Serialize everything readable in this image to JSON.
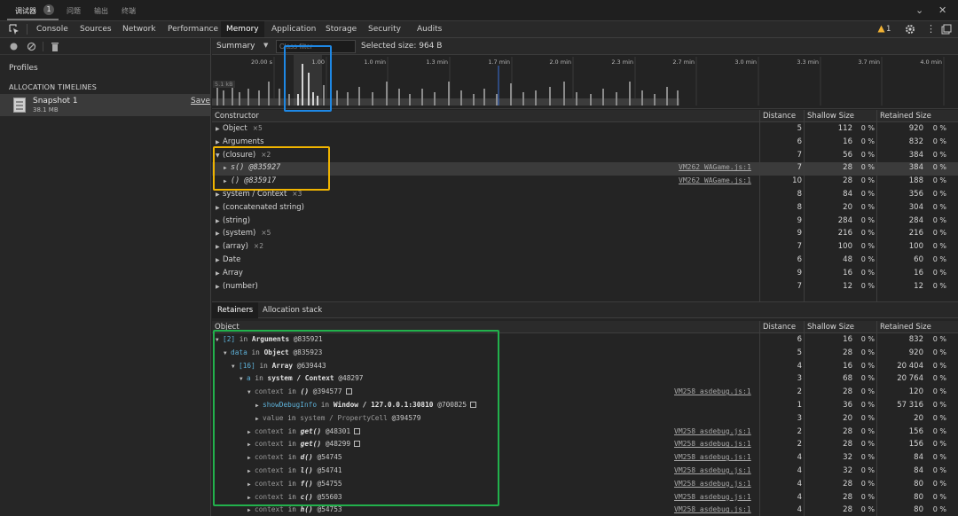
{
  "drawer": {
    "tabs": [
      "调试器",
      "问题",
      "输出",
      "终端"
    ],
    "badge": "1",
    "more_icon": "chevron-down-icon",
    "close_icon": "close-icon"
  },
  "panels": {
    "tabs": [
      "Console",
      "Sources",
      "Network",
      "Performance",
      "Memory",
      "Application",
      "Storage",
      "Security",
      "Audits"
    ],
    "active": "Memory",
    "warning_count": "1",
    "warning_icon": "warning-icon",
    "warning_color": "#f2b233"
  },
  "sidebar": {
    "profiles_label": "Profiles",
    "section_label": "ALLOCATION TIMELINES",
    "snapshot": {
      "name": "Snapshot 1",
      "size": "38.1 MB",
      "save_label": "Save"
    }
  },
  "toolbar": {
    "view": "Summary",
    "filter_placeholder": "Class filter",
    "selected_size": "Selected size: 964 B"
  },
  "timeline": {
    "ticks": [
      "20.00 s",
      "1.00",
      "1.0 min",
      "1.3 min",
      "1.7 min",
      "2.0 min",
      "2.3 min",
      "2.7 min",
      "3.0 min",
      "3.3 min",
      "3.7 min",
      "4.0 min"
    ],
    "scale_label": "5.1 kB"
  },
  "constructor_table": {
    "columns": [
      "Constructor",
      "Distance",
      "Shallow Size",
      "Retained Size"
    ],
    "rows": [
      {
        "name": "Object",
        "count": "×5",
        "link": "",
        "distance": "5",
        "shallow": "112",
        "shallow_pct": "0 %",
        "retained": "920",
        "retained_pct": "0 %"
      },
      {
        "name": "Arguments",
        "count": "",
        "link": "",
        "distance": "6",
        "shallow": "16",
        "shallow_pct": "0 %",
        "retained": "832",
        "retained_pct": "0 %"
      },
      {
        "name": "(closure)",
        "count": "×2",
        "link": "",
        "distance": "7",
        "shallow": "56",
        "shallow_pct": "0 %",
        "retained": "384",
        "retained_pct": "0 %"
      },
      {
        "name": "s() @835927",
        "count": "",
        "link": "VM262 WAGame.js:1",
        "distance": "7",
        "shallow": "28",
        "shallow_pct": "0 %",
        "retained": "384",
        "retained_pct": "0 %"
      },
      {
        "name": "() @835917",
        "count": "",
        "link": "VM262 WAGame.js:1",
        "distance": "10",
        "shallow": "28",
        "shallow_pct": "0 %",
        "retained": "188",
        "retained_pct": "0 %"
      },
      {
        "name": "system / Context",
        "count": "×3",
        "link": "",
        "distance": "8",
        "shallow": "84",
        "shallow_pct": "0 %",
        "retained": "356",
        "retained_pct": "0 %"
      },
      {
        "name": "(concatenated string)",
        "count": "",
        "link": "",
        "distance": "8",
        "shallow": "20",
        "shallow_pct": "0 %",
        "retained": "304",
        "retained_pct": "0 %"
      },
      {
        "name": "(string)",
        "count": "",
        "link": "",
        "distance": "9",
        "shallow": "284",
        "shallow_pct": "0 %",
        "retained": "284",
        "retained_pct": "0 %"
      },
      {
        "name": "(system)",
        "count": "×5",
        "link": "",
        "distance": "9",
        "shallow": "216",
        "shallow_pct": "0 %",
        "retained": "216",
        "retained_pct": "0 %"
      },
      {
        "name": "(array)",
        "count": "×2",
        "link": "",
        "distance": "7",
        "shallow": "100",
        "shallow_pct": "0 %",
        "retained": "100",
        "retained_pct": "0 %"
      },
      {
        "name": "Date",
        "count": "",
        "link": "",
        "distance": "6",
        "shallow": "48",
        "shallow_pct": "0 %",
        "retained": "60",
        "retained_pct": "0 %"
      },
      {
        "name": "Array",
        "count": "",
        "link": "",
        "distance": "9",
        "shallow": "16",
        "shallow_pct": "0 %",
        "retained": "16",
        "retained_pct": "0 %"
      },
      {
        "name": "(number)",
        "count": "",
        "link": "",
        "distance": "7",
        "shallow": "12",
        "shallow_pct": "0 %",
        "retained": "12",
        "retained_pct": "0 %"
      }
    ]
  },
  "bottom_tabs": [
    "Retainers",
    "Allocation stack"
  ],
  "retainers_table": {
    "columns": [
      "Object",
      "Distance",
      "Shallow Size",
      "Retained Size"
    ],
    "rows": [
      {
        "key": "[2]",
        "in": "in",
        "target": "Arguments",
        "id": "@835921",
        "link": "",
        "distance": "6",
        "shallow": "16",
        "shallow_pct": "0 %",
        "retained": "832",
        "retained_pct": "0 %"
      },
      {
        "key": "data",
        "in": "in",
        "target": "Object",
        "id": "@835923",
        "link": "",
        "distance": "5",
        "shallow": "28",
        "shallow_pct": "0 %",
        "retained": "920",
        "retained_pct": "0 %"
      },
      {
        "key": "[16]",
        "in": "in",
        "target": "Array",
        "id": "@639443",
        "link": "",
        "distance": "4",
        "shallow": "16",
        "shallow_pct": "0 %",
        "retained": "20 404",
        "retained_pct": "0 %"
      },
      {
        "key": "a",
        "in": "in",
        "target": "system / Context",
        "id": "@48297",
        "link": "",
        "distance": "3",
        "shallow": "68",
        "shallow_pct": "0 %",
        "retained": "20 764",
        "retained_pct": "0 %"
      },
      {
        "key": "context",
        "in": "in",
        "target": "()",
        "id": "@394577",
        "link": "VM258 asdebug.js:1",
        "distance": "2",
        "shallow": "28",
        "shallow_pct": "0 %",
        "retained": "120",
        "retained_pct": "0 %"
      },
      {
        "key": "showDebugInfo",
        "in": "in",
        "target": "Window / 127.0.0.1:30810",
        "id": "@700825",
        "link": "",
        "distance": "1",
        "shallow": "36",
        "shallow_pct": "0 %",
        "retained": "57 316",
        "retained_pct": "0 %"
      },
      {
        "key": "value",
        "in": "in",
        "target": "system / PropertyCell",
        "id": "@394579",
        "link": "",
        "distance": "3",
        "shallow": "20",
        "shallow_pct": "0 %",
        "retained": "20",
        "retained_pct": "0 %"
      },
      {
        "key": "context",
        "in": "in",
        "target": "get()",
        "id": "@48301",
        "link": "VM258 asdebug.js:1",
        "distance": "2",
        "shallow": "28",
        "shallow_pct": "0 %",
        "retained": "156",
        "retained_pct": "0 %"
      },
      {
        "key": "context",
        "in": "in",
        "target": "get()",
        "id": "@48299",
        "link": "VM258 asdebug.js:1",
        "distance": "2",
        "shallow": "28",
        "shallow_pct": "0 %",
        "retained": "156",
        "retained_pct": "0 %"
      },
      {
        "key": "context",
        "in": "in",
        "target": "d()",
        "id": "@54745",
        "link": "VM258 asdebug.js:1",
        "distance": "4",
        "shallow": "32",
        "shallow_pct": "0 %",
        "retained": "84",
        "retained_pct": "0 %"
      },
      {
        "key": "context",
        "in": "in",
        "target": "l()",
        "id": "@54741",
        "link": "VM258 asdebug.js:1",
        "distance": "4",
        "shallow": "32",
        "shallow_pct": "0 %",
        "retained": "84",
        "retained_pct": "0 %"
      },
      {
        "key": "context",
        "in": "in",
        "target": "f()",
        "id": "@54755",
        "link": "VM258 asdebug.js:1",
        "distance": "4",
        "shallow": "28",
        "shallow_pct": "0 %",
        "retained": "80",
        "retained_pct": "0 %"
      },
      {
        "key": "context",
        "in": "in",
        "target": "c()",
        "id": "@55603",
        "link": "VM258 asdebug.js:1",
        "distance": "4",
        "shallow": "28",
        "shallow_pct": "0 %",
        "retained": "80",
        "retained_pct": "0 %"
      },
      {
        "key": "context",
        "in": "in",
        "target": "h()",
        "id": "@54753",
        "link": "VM258 asdebug.js:1",
        "distance": "4",
        "shallow": "28",
        "shallow_pct": "0 %",
        "retained": "80",
        "retained_pct": "0 %"
      }
    ]
  },
  "annotation_colors": {
    "timeline_box": "#1e88e5",
    "closure_box": "#f0b400",
    "retainers_box": "#22b14c"
  }
}
